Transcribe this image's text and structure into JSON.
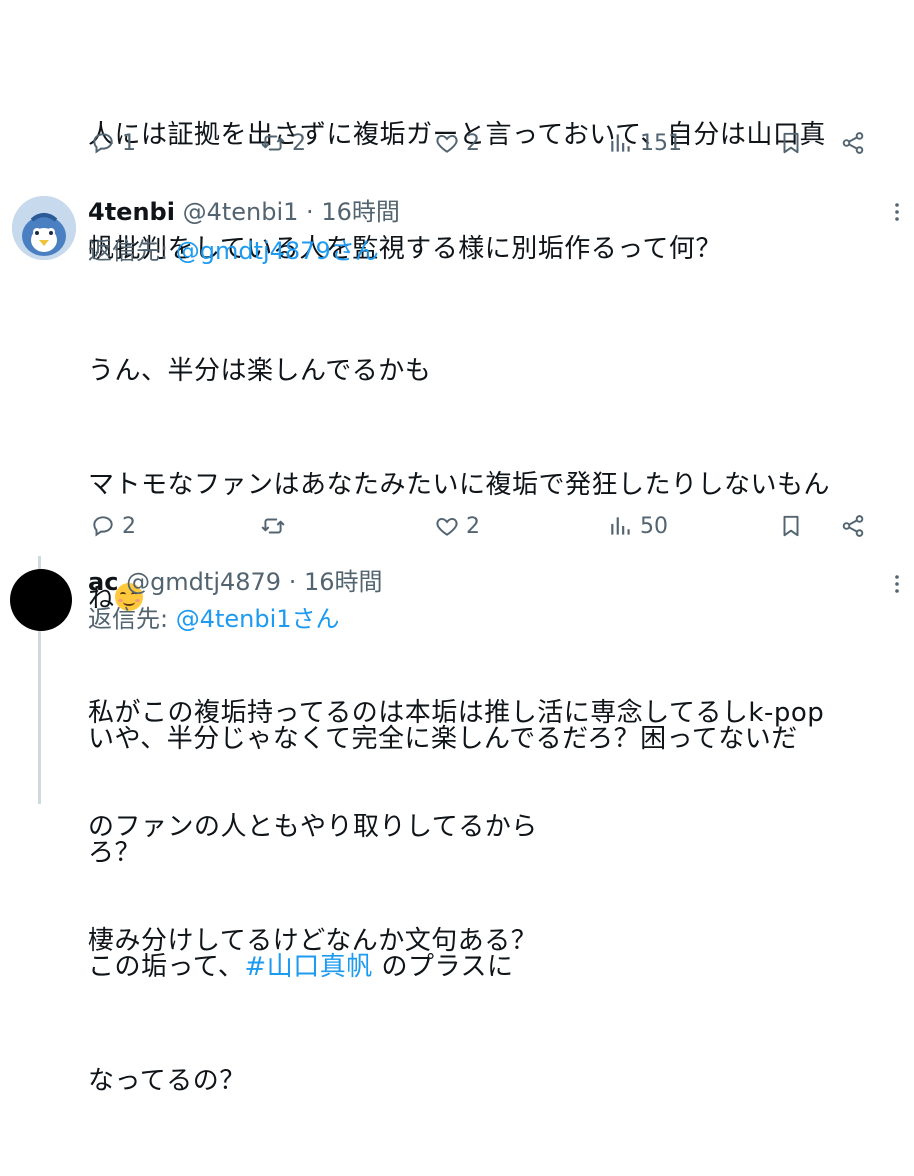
{
  "tweet1": {
    "line1": "人には証拠を出さずに複垢ガーと言っておいて、自分は山口真",
    "line2": "帆批判をしている人を監視する様に別垢作るって何？",
    "replies": "1",
    "retweets": "2",
    "likes": "2",
    "views": "151"
  },
  "tweet2": {
    "display_name": "4tenbi",
    "handle": "@4tenbi1",
    "time": "16時間",
    "reply_to_prefix": "返信先: ",
    "reply_to_handle": "@gmdtj4879さん",
    "line1": "うん、半分は楽しんでるかも",
    "line2": "マトモなファンはあなたみたいに複垢で発狂したりしないもん",
    "line3": "ね",
    "line4": "私がこの複垢持ってるのは本垢は推し活に専念してるしk-pop",
    "line5": "のファンの人ともやり取りしてるから",
    "line6": "棲み分けしてるけどなんか文句ある？",
    "replies": "2",
    "retweets": "",
    "likes": "2",
    "views": "50"
  },
  "tweet3": {
    "display_name": "ac",
    "handle": "@gmdtj4879",
    "time": "16時間",
    "reply_to_prefix": "返信先: ",
    "reply_to_handle": "@4tenbi1さん",
    "line1": "いや、半分じゃなくて完全に楽しんでるだろ？困ってないだ",
    "line2": "ろ？",
    "line3_prefix": "この垢って、",
    "hashtag": "#山口真帆",
    "line3_suffix": " のプラスに",
    "line4": "なってるの？"
  },
  "separator": " · ",
  "icons": {
    "reply": "reply-icon",
    "retweet": "retweet-icon",
    "like": "like-icon",
    "views": "views-icon",
    "bookmark": "bookmark-icon",
    "share": "share-icon",
    "more": "more-icon",
    "emoji": "smiling-face-emoji"
  },
  "colors": {
    "text": "#0f1419",
    "secondary": "#536471",
    "link": "#1d9bf0",
    "thread_line": "#cfd9de"
  }
}
